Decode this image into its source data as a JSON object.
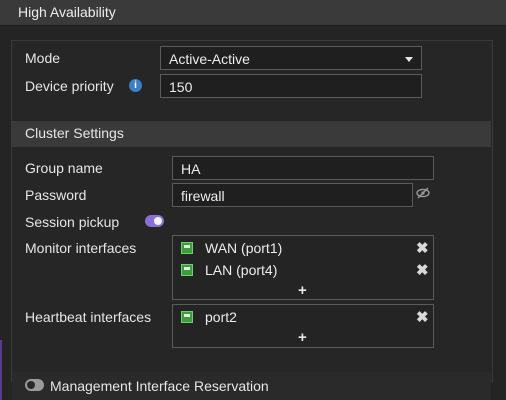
{
  "header": {
    "title": "High Availability"
  },
  "mode": {
    "label": "Mode",
    "value": "Active-Active"
  },
  "priority": {
    "label": "Device priority",
    "value": "150"
  },
  "cluster": {
    "section_title": "Cluster Settings",
    "group_name_label": "Group name",
    "group_name_value": "HA",
    "password_label": "Password",
    "password_value": "firewall",
    "session_pickup_label": "Session pickup",
    "session_pickup_enabled": true
  },
  "monitor": {
    "label": "Monitor interfaces",
    "items": [
      {
        "name": "WAN (port1)"
      },
      {
        "name": "LAN (port4)"
      }
    ],
    "add_label": "+"
  },
  "heartbeat": {
    "label": "Heartbeat interfaces",
    "items": [
      {
        "name": "port2"
      }
    ],
    "add_label": "+"
  },
  "management": {
    "label": "Management Interface Reservation",
    "enabled": false
  },
  "colors": {
    "accent": "#8a70d6",
    "info": "#3d7fc3",
    "iface": "#3d9d3d"
  }
}
